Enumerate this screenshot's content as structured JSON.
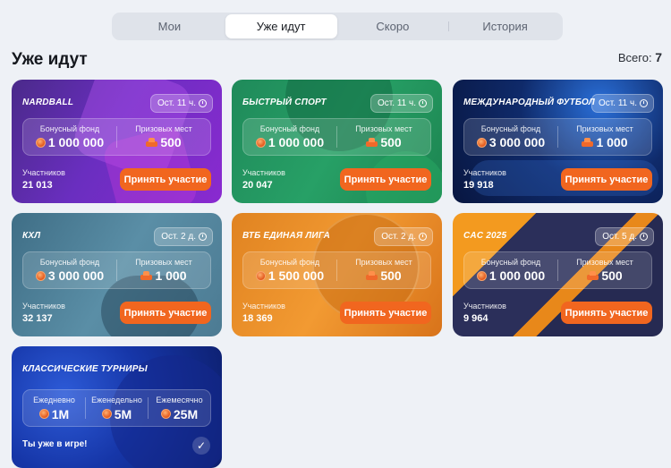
{
  "tabs": [
    {
      "label": "Мои"
    },
    {
      "label": "Уже идут"
    },
    {
      "label": "Скоро"
    },
    {
      "label": "История"
    }
  ],
  "active_tab": "Уже идут",
  "section": {
    "title": "Уже идут",
    "total_label": "Всего:",
    "total_value": "7"
  },
  "labels": {
    "bonus_fund": "Бонусный фонд",
    "prize_places": "Призовых мест",
    "participants": "Участников",
    "join": "Принять участие"
  },
  "tournaments": [
    {
      "name": "NARDBALL",
      "time_left": "Ост. 11 ч.",
      "bonus_fund": "1 000 000",
      "prize_places": "500",
      "participants": "21 013"
    },
    {
      "name": "БЫСТРЫЙ СПОРТ",
      "time_left": "Ост. 11 ч.",
      "bonus_fund": "1 000 000",
      "prize_places": "500",
      "participants": "20 047"
    },
    {
      "name": "МЕЖДУНАРОДНЫЙ ФУТБОЛ",
      "time_left": "Ост. 11 ч.",
      "bonus_fund": "3 000 000",
      "prize_places": "1 000",
      "participants": "19 918"
    },
    {
      "name": "КХЛ",
      "time_left": "Ост. 2 д.",
      "bonus_fund": "3 000 000",
      "prize_places": "1 000",
      "participants": "32 137"
    },
    {
      "name": "ВТБ ЕДИНАЯ ЛИГА",
      "time_left": "Ост. 2 д.",
      "bonus_fund": "1 500 000",
      "prize_places": "500",
      "participants": "18 369"
    },
    {
      "name": "CAC 2025",
      "time_left": "Ост. 5 д.",
      "bonus_fund": "1 000 000",
      "prize_places": "500",
      "participants": "9 964"
    }
  ],
  "classic": {
    "name": "КЛАССИЧЕСКИЕ ТУРНИРЫ",
    "periods": [
      {
        "label": "Ежедневно",
        "value": "1M"
      },
      {
        "label": "Еженедельно",
        "value": "5M"
      },
      {
        "label": "Ежемесячно",
        "value": "25M"
      }
    ],
    "status": "Ты уже в игре!",
    "check_icon": "check-icon"
  },
  "colors": {
    "accent": "#f1661f",
    "active_tab_bg": "#ffffff",
    "page_bg": "#eef1f6"
  }
}
